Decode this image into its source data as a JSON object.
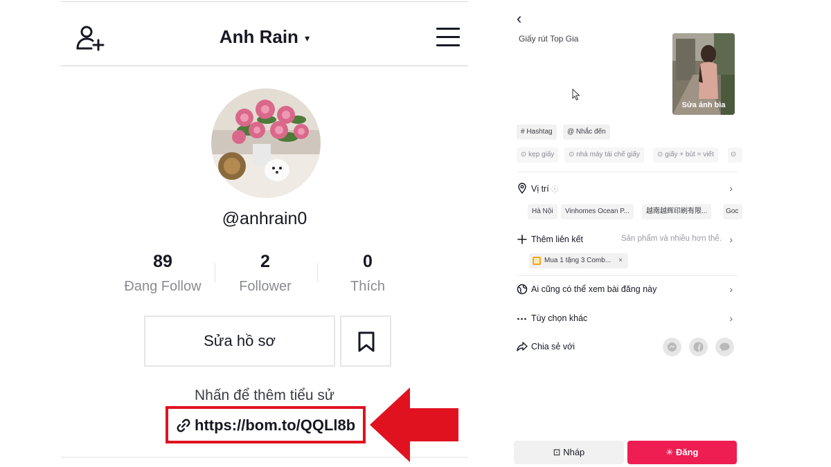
{
  "profile": {
    "title": "Anh Rain",
    "caret": "▾",
    "handle": "@anhrain0",
    "stats": [
      {
        "num": "89",
        "label": "Đang Follow"
      },
      {
        "num": "2",
        "label": "Follower"
      },
      {
        "num": "0",
        "label": "Thích"
      }
    ],
    "edit_label": "Sửa hồ sơ",
    "bio_prompt": "Nhấn để thêm tiểu sử",
    "link": "https://bom.to/QQLl8b"
  },
  "post": {
    "back": "‹",
    "caption": "Giấy rút Top Gia",
    "cover_label": "Sửa ảnh bìa",
    "tags": [
      "# Hashtag",
      "@ Nhắc đến"
    ],
    "suggestions": [
      "⊙ kẹp giấy",
      "⊙ nhà máy tái chế giấy",
      "⊙ giấy + bút = viết",
      "⊙"
    ],
    "location": {
      "label": "Vị trí",
      "info": "ⓘ"
    },
    "location_chips": [
      "Hà Nội",
      "Vinhomes Ocean P...",
      "越南越辉印刷有限...",
      "Goc"
    ],
    "add_link": {
      "label": "Thêm liên kết",
      "hint": "Sản phẩm và nhiều hơn thế."
    },
    "product": {
      "label": "Mua 1 tặng 3 Comb...",
      "close": "×"
    },
    "privacy": "Ai cũng có thể xem bài đăng này",
    "more": "Tùy chọn khác",
    "share": "Chia sẻ với",
    "draft": "⊡ Nháp",
    "publish": "✳ Đăng",
    "chevron": "›"
  },
  "colors": {
    "accent": "#ee1d52",
    "highlight": "#e01220"
  }
}
